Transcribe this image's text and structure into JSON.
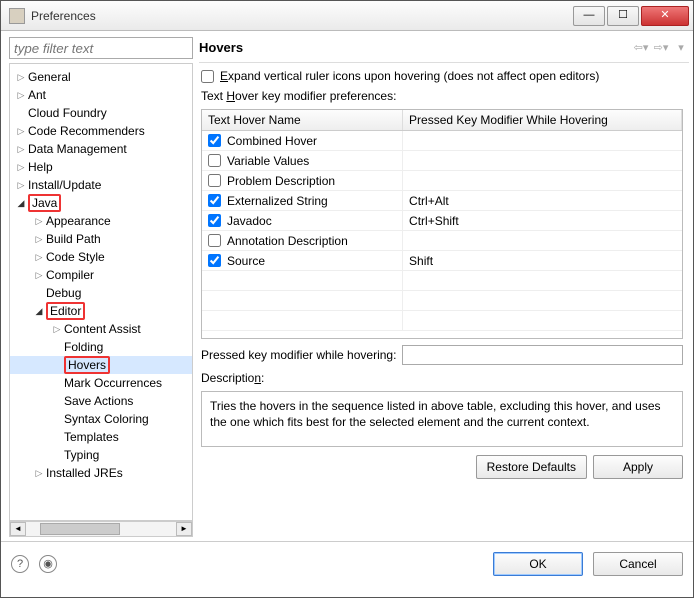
{
  "window": {
    "title": "Preferences"
  },
  "filter": {
    "placeholder": "type filter text"
  },
  "tree": [
    {
      "label": "General",
      "indent": 0,
      "arrow": "closed"
    },
    {
      "label": "Ant",
      "indent": 0,
      "arrow": "closed"
    },
    {
      "label": "Cloud Foundry",
      "indent": 0,
      "arrow": "none"
    },
    {
      "label": "Code Recommenders",
      "indent": 0,
      "arrow": "closed"
    },
    {
      "label": "Data Management",
      "indent": 0,
      "arrow": "closed"
    },
    {
      "label": "Help",
      "indent": 0,
      "arrow": "closed"
    },
    {
      "label": "Install/Update",
      "indent": 0,
      "arrow": "closed"
    },
    {
      "label": "Java",
      "indent": 0,
      "arrow": "open",
      "boxed": true
    },
    {
      "label": "Appearance",
      "indent": 1,
      "arrow": "closed"
    },
    {
      "label": "Build Path",
      "indent": 1,
      "arrow": "closed"
    },
    {
      "label": "Code Style",
      "indent": 1,
      "arrow": "closed"
    },
    {
      "label": "Compiler",
      "indent": 1,
      "arrow": "closed"
    },
    {
      "label": "Debug",
      "indent": 1,
      "arrow": "none"
    },
    {
      "label": "Editor",
      "indent": 1,
      "arrow": "open",
      "boxed": true
    },
    {
      "label": "Content Assist",
      "indent": 2,
      "arrow": "closed"
    },
    {
      "label": "Folding",
      "indent": 2,
      "arrow": "none"
    },
    {
      "label": "Hovers",
      "indent": 2,
      "arrow": "none",
      "boxed": true,
      "selected": true
    },
    {
      "label": "Mark Occurrences",
      "indent": 2,
      "arrow": "none"
    },
    {
      "label": "Save Actions",
      "indent": 2,
      "arrow": "none"
    },
    {
      "label": "Syntax Coloring",
      "indent": 2,
      "arrow": "none"
    },
    {
      "label": "Templates",
      "indent": 2,
      "arrow": "none"
    },
    {
      "label": "Typing",
      "indent": 2,
      "arrow": "none"
    },
    {
      "label": "Installed JREs",
      "indent": 1,
      "arrow": "closed"
    }
  ],
  "main": {
    "title": "Hovers",
    "expand_checkbox": {
      "checked": false,
      "label_pre": "",
      "label_key": "E",
      "label_post": "xpand vertical ruler icons upon hovering (does not affect open editors)"
    },
    "table_label_pre": "Text ",
    "table_label_key": "H",
    "table_label_post": "over key modifier preferences:",
    "columns": [
      "Text Hover Name",
      "Pressed Key Modifier While Hovering"
    ],
    "rows": [
      {
        "checked": true,
        "name": "Combined Hover",
        "mod": ""
      },
      {
        "checked": false,
        "name": "Variable Values",
        "mod": ""
      },
      {
        "checked": false,
        "name": "Problem Description",
        "mod": ""
      },
      {
        "checked": true,
        "name": "Externalized String",
        "mod": "Ctrl+Alt"
      },
      {
        "checked": true,
        "name": "Javadoc",
        "mod": "Ctrl+Shift"
      },
      {
        "checked": false,
        "name": "Annotation Description",
        "mod": ""
      },
      {
        "checked": true,
        "name": "Source",
        "mod": "Shift"
      }
    ],
    "pressed_label": "Pressed key modifier while hovering:",
    "pressed_value": "",
    "desc_label_pre": "Descriptio",
    "desc_label_key": "n",
    "desc_label_post": ":",
    "description": "Tries the hovers in the sequence listed in above table, excluding this hover, and uses the one which fits best for the selected element and the current context.",
    "restore": "Restore Defaults",
    "apply": "Apply"
  },
  "footer": {
    "ok": "OK",
    "cancel": "Cancel"
  }
}
